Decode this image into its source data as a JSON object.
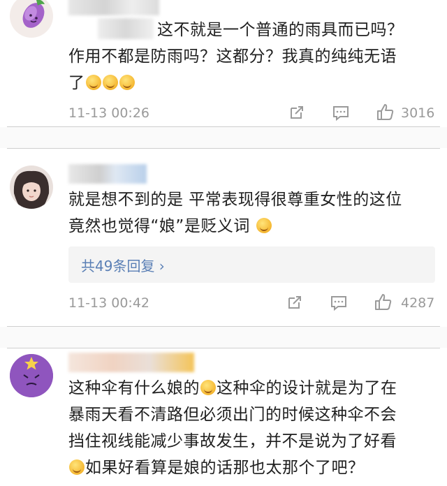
{
  "comments": [
    {
      "text_lines": [
        "这不就是一个普通的雨具而已吗？",
        "作用不都是防雨吗？这都分？我真的纯纯无语",
        "了"
      ],
      "time": "11-13 00:26",
      "likes": "3016"
    },
    {
      "text_lines": [
        "就是想不到的是 平常表现得很尊重女性的这位",
        "竟然也觉得“娘”是贬义词"
      ],
      "replies_label": "共49条回复 ›",
      "time": "11-13 00:42",
      "likes": "4287"
    },
    {
      "text_lines": [
        "这种伞有什么娘的",
        "这种伞的设计就是为了在",
        "暴雨天看不清路但必须出门的时候这种伞不会",
        "挡住视线能减少事故发生，并不是说为了好看",
        "如果好看算是娘的话那也太那个了吧？"
      ]
    }
  ],
  "icons": [
    "avatar-eggplant",
    "avatar-girl",
    "avatar-purple-star",
    "share-icon",
    "comment-icon",
    "like-icon",
    "laugh-emoji-icon",
    "sweat-emoji-icon"
  ],
  "colors": {
    "reply_link": "#5a7fb5",
    "meta_gray": "#9a9a9a",
    "divider": "#cfcfcf"
  }
}
